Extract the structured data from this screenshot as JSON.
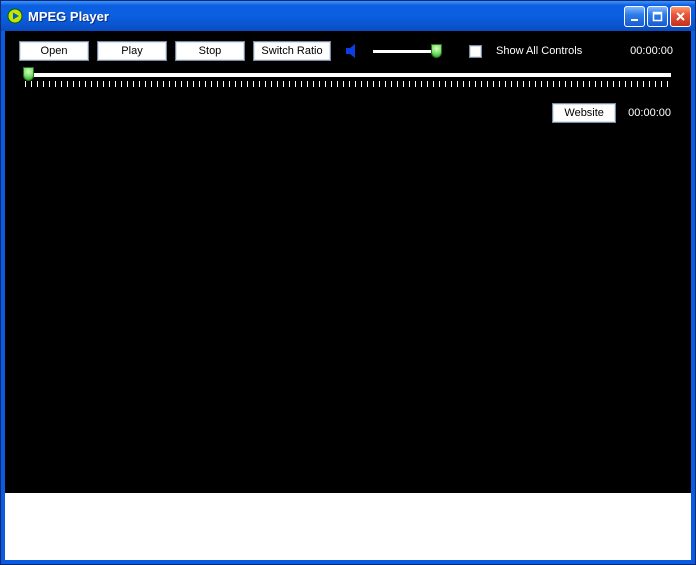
{
  "window": {
    "title": "MPEG Player"
  },
  "toolbar": {
    "open_label": "Open",
    "play_label": "Play",
    "stop_label": "Stop",
    "switch_ratio_label": "Switch Ratio",
    "show_all_controls_label": "Show All Controls",
    "show_all_controls_checked": false,
    "time_top": "00:00:00"
  },
  "seek": {
    "position_pct": 0
  },
  "volume": {
    "level_pct": 100
  },
  "row2": {
    "website_label": "Website",
    "time_bottom": "00:00:00"
  }
}
